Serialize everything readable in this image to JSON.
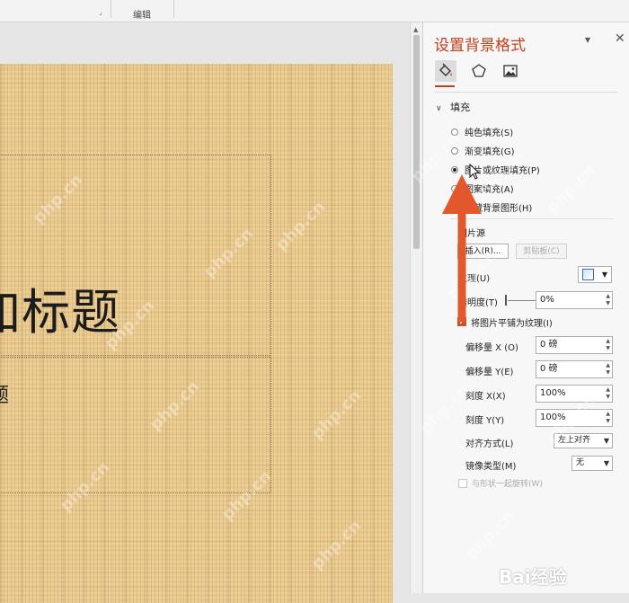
{
  "ribbon": {
    "group_label": "编辑"
  },
  "slide": {
    "title": "加标题",
    "subtitle": "题"
  },
  "pane": {
    "title": "设置背景格式",
    "tabs": [
      {
        "icon": "paint-bucket-icon",
        "active": true
      },
      {
        "icon": "pentagon-icon",
        "active": false
      },
      {
        "icon": "picture-icon",
        "active": false
      }
    ],
    "section": "填充",
    "fill_options": [
      {
        "label": "纯色填充(S)",
        "checked": false
      },
      {
        "label": "渐变填充(G)",
        "checked": false
      },
      {
        "label": "图片或纹理填充(P)",
        "checked": true
      },
      {
        "label": "图案填充(A)",
        "checked": false
      },
      {
        "label": "隐藏背景图形(H)",
        "checked": false
      }
    ],
    "picture_source": "图片源",
    "insert_button": "插入(R)...",
    "clipboard_button": "剪贴板(C)",
    "texture_label": "纹理(U)",
    "transparency_label": "透明度(T)",
    "transparency_value": "0%",
    "tile_checkbox": "将图片平铺为纹理(I)",
    "offset_x_label": "偏移量 X (O)",
    "offset_x_value": "0 磅",
    "offset_y_label": "偏移量 Y(E)",
    "offset_y_value": "0 磅",
    "scale_x_label": "刻度 X(X)",
    "scale_x_value": "100%",
    "scale_y_label": "刻度 Y(Y)",
    "scale_y_value": "100%",
    "align_label": "对齐方式(L)",
    "align_value": "左上对齐",
    "mirror_label": "镜像类型(M)",
    "mirror_value": "无",
    "rotate_with_shape": "与形状一起旋转(W)"
  },
  "watermark": {
    "site": "php.cn",
    "baidu": "Bai经验"
  },
  "colors": {
    "accent": "#c43e1c",
    "arrow": "#e2572c",
    "slide_bg": "#e9c88c"
  }
}
